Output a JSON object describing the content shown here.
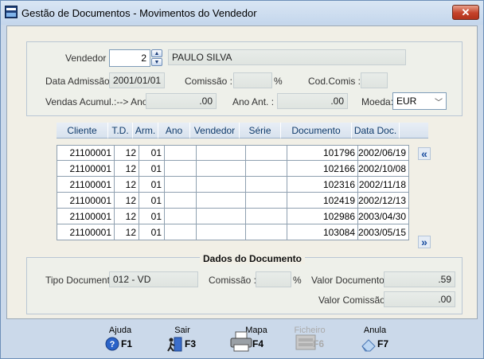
{
  "window": {
    "title": "Gestão de Documentos - Movimentos do Vendedor",
    "close_label": "✕"
  },
  "vendor": {
    "vendedor_label": "Vendedor :",
    "vendedor_code": "2",
    "vendedor_name": "PAULO SILVA",
    "data_admissao_label": "Data Admissão :",
    "data_admissao": "2001/01/01",
    "comissao_label": "Comissão :",
    "comissao_value": "",
    "percent": "%",
    "codcomis_label": "Cod.Comis :",
    "codcomis_value": "",
    "vendas_label": "Vendas Acumul.:-->  Ano :",
    "vendas_ano": ".00",
    "ano_ant_label": "Ano Ant. :",
    "ano_ant": ".00",
    "moeda_label": "Moeda:",
    "moeda": "EUR"
  },
  "table": {
    "columns": [
      "Cliente",
      "T.D.",
      "Arm.",
      "Ano",
      "Vendedor",
      "Série",
      "Documento",
      "Data Doc."
    ],
    "rows": [
      [
        "21100001",
        "12",
        "01",
        "",
        "",
        "",
        "101796",
        "2002/06/19"
      ],
      [
        "21100001",
        "12",
        "01",
        "",
        "",
        "",
        "102166",
        "2002/10/08"
      ],
      [
        "21100001",
        "12",
        "01",
        "",
        "",
        "",
        "102316",
        "2002/11/18"
      ],
      [
        "21100001",
        "12",
        "01",
        "",
        "",
        "",
        "102419",
        "2002/12/13"
      ],
      [
        "21100001",
        "12",
        "01",
        "",
        "",
        "",
        "102986",
        "2003/04/30"
      ],
      [
        "21100001",
        "12",
        "01",
        "",
        "",
        "",
        "103084",
        "2003/05/15"
      ]
    ],
    "nav_up": "«",
    "nav_down": "»"
  },
  "document": {
    "section_title": "Dados do Documento",
    "tipo_label": "Tipo Documento :",
    "tipo_value": "012 - VD",
    "comissao_label": "Comissão :",
    "comissao_value": "",
    "percent": "%",
    "valor_doc_label": "Valor Documento :",
    "valor_doc": ".59",
    "valor_comissao_label": "Valor Comissão :",
    "valor_comissao": ".00"
  },
  "toolbar": {
    "ajuda": {
      "label": "Ajuda",
      "key": "F1"
    },
    "sair": {
      "label": "Sair",
      "key": "F3"
    },
    "mapa": {
      "label": "Mapa",
      "key": "F4"
    },
    "ficheiro": {
      "label": "Ficheiro",
      "key": "F6"
    },
    "anula": {
      "label": "Anula",
      "key": "F7"
    }
  },
  "colors": {
    "titlebar": "#c4d6ec",
    "client": "#f1efe6",
    "close": "#c4422a"
  }
}
